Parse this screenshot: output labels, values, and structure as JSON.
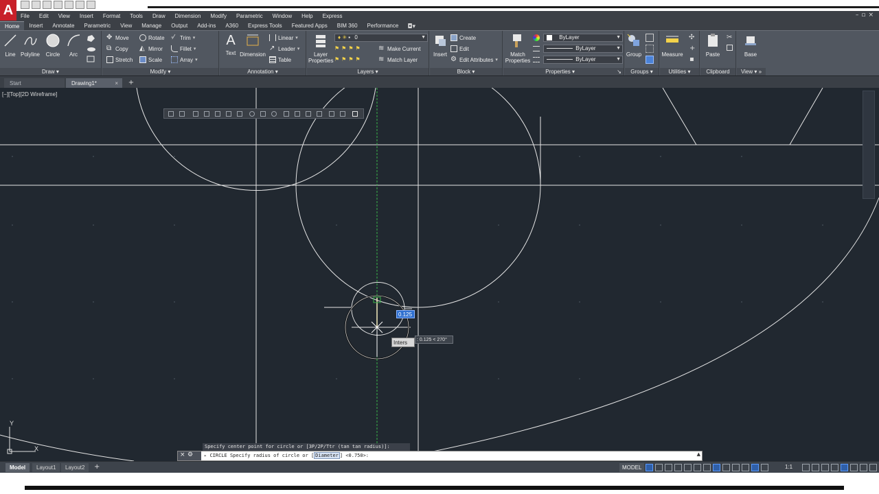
{
  "menu": [
    "File",
    "Edit",
    "View",
    "Insert",
    "Format",
    "Tools",
    "Draw",
    "Dimension",
    "Modify",
    "Parametric",
    "Window",
    "Help",
    "Express"
  ],
  "ribbon_tabs": [
    "Home",
    "Insert",
    "Annotate",
    "Parametric",
    "View",
    "Manage",
    "Output",
    "Add-ins",
    "A360",
    "Express Tools",
    "Featured Apps",
    "BIM 360",
    "Performance"
  ],
  "ribbon": {
    "draw": {
      "title": "Draw",
      "line": "Line",
      "polyline": "Polyline",
      "circle": "Circle",
      "arc": "Arc"
    },
    "modify": {
      "title": "Modify",
      "move": "Move",
      "rotate": "Rotate",
      "trim": "Trim",
      "copy": "Copy",
      "mirror": "Mirror",
      "fillet": "Fillet",
      "stretch": "Stretch",
      "scale": "Scale",
      "array": "Array"
    },
    "annotation": {
      "title": "Annotation",
      "text": "Text",
      "dimension": "Dimension",
      "linear": "Linear",
      "leader": "Leader",
      "table": "Table"
    },
    "layers": {
      "title": "Layers",
      "layer_properties_1": "Layer",
      "layer_properties_2": "Properties",
      "layer_value": "0",
      "make_current": "Make Current",
      "match_layer": "Match Layer"
    },
    "block": {
      "title": "Block",
      "insert": "Insert",
      "create": "Create",
      "edit": "Edit",
      "edit_attributes": "Edit Attributes"
    },
    "properties": {
      "title": "Properties",
      "match_1": "Match",
      "match_2": "Properties",
      "color": "ByLayer",
      "linetype": "ByLayer",
      "lineweight": "ByLayer"
    },
    "groups": {
      "title": "Groups",
      "group": "Group"
    },
    "utilities": {
      "title": "Utilities",
      "measure": "Measure"
    },
    "clipboard": {
      "title": "Clipboard",
      "paste": "Paste"
    },
    "view": {
      "title": "View",
      "base": "Base"
    }
  },
  "file_tabs": {
    "start": "Start",
    "drawing": "Drawing1*"
  },
  "viewport_label": "[−][Top][2D Wireframe]",
  "dynamic_input": "0.125",
  "snap_tooltip": "Inters",
  "polar_tooltip": ": 0.125 < 270°",
  "command": {
    "history": "Specify center point for circle or [3P/2P/Ttr (tan tan radius)]:",
    "prompt_pre": "CIRCLE Specify radius of circle or [",
    "prompt_keyword": "Diameter",
    "prompt_post": "] <0.750>:"
  },
  "ucs": {
    "x": "X",
    "y": "Y"
  },
  "layout_tabs": [
    "Model",
    "Layout1",
    "Layout2"
  ],
  "status": {
    "model": "MODEL",
    "scale": "1:1"
  },
  "colors": {
    "canvas": "#212830",
    "ribbon": "#515760",
    "accent_red": "#c8202a",
    "highlight_blue": "#2e6fcf"
  }
}
